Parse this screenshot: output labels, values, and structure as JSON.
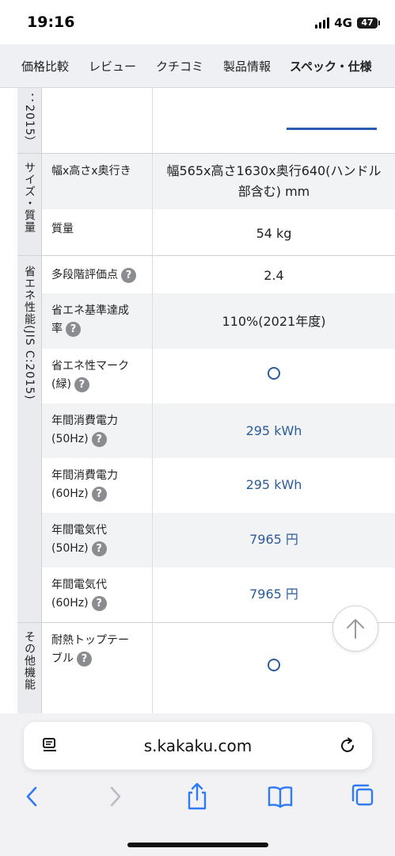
{
  "status_bar": {
    "time": "19:16",
    "network": "4G",
    "battery": "47"
  },
  "tabs": [
    {
      "label": "価格比較"
    },
    {
      "label": "レビュー"
    },
    {
      "label": "クチコミ"
    },
    {
      "label": "製品情報"
    },
    {
      "label": "スペック・仕様"
    }
  ],
  "active_tab": "スペック・仕様",
  "spec_table": {
    "top_category_partial": "：2015）",
    "categories": [
      {
        "name": "サイズ・質量"
      },
      {
        "name": "省エネ性能(JIS C:2015)"
      },
      {
        "name": "その他機能"
      }
    ],
    "rows": [
      {
        "label": "幅x高さx奥行き",
        "value": "幅565x高さ1630x奥行640(ハンドル部含む) mm"
      },
      {
        "label": "質量",
        "value": "54 kg"
      },
      {
        "label": "多段階評価点",
        "value": "2.4"
      },
      {
        "label": "省エネ基準達成率",
        "value": "110%(2021年度)"
      },
      {
        "label": "省エネ性マーク(緑)",
        "value": "○"
      },
      {
        "label": "年間消費電力(50Hz)",
        "value": "295 kWh"
      },
      {
        "label": "年間消費電力(60Hz)",
        "value": "295 kWh"
      },
      {
        "label": "年間電気代(50Hz)",
        "value": "7965 円"
      },
      {
        "label": "年間電気代(60Hz)",
        "value": "7965 円"
      },
      {
        "label": "耐熱トップテーブル",
        "value": "○"
      }
    ],
    "help_icon_text": "?"
  },
  "browser": {
    "url": "s.kakaku.com"
  },
  "colors": {
    "accent": "#2b5bb5",
    "link_value": "#2b5b9a",
    "category_bg": "#e9ebee",
    "row_alt_bg": "#f2f3f5"
  }
}
